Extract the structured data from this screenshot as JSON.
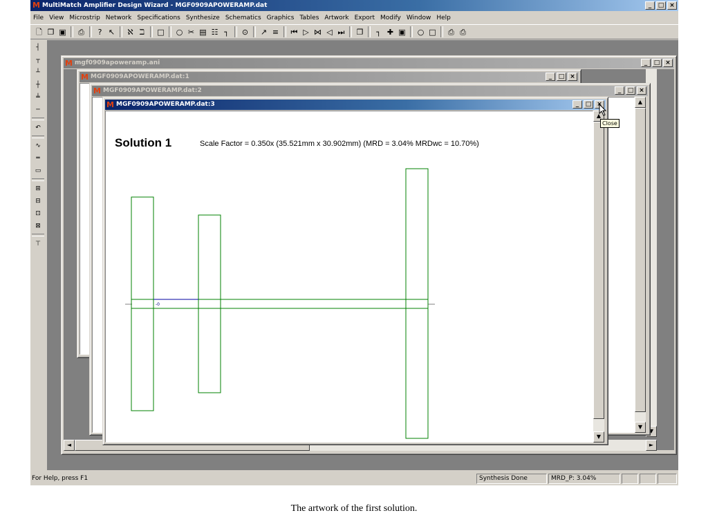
{
  "app": {
    "title": "MultiMatch Amplifier Design Wizard - MGF0909APOWERAMP.dat",
    "window_buttons": [
      "_",
      "□",
      "×"
    ]
  },
  "menu": [
    "File",
    "View",
    "Microstrip",
    "Network",
    "Specifications",
    "Synthesize",
    "Schematics",
    "Graphics",
    "Tables",
    "Artwork",
    "Export",
    "Modify",
    "Window",
    "Help"
  ],
  "toolbar_icons": [
    "new-file-icon",
    "open-folder-icon",
    "save-icon",
    "print-icon",
    "help-icon",
    "context-help-icon",
    "artwork-icon",
    "artwork-alt-icon",
    "layout-icon",
    "circle-icon",
    "scissors-icon",
    "grid-icon",
    "network-icon",
    "schematic-icon",
    "target-icon",
    "tune-icon",
    "sweep-icon",
    "first-icon",
    "play-icon",
    "next-icon",
    "prev-icon",
    "last-icon",
    "copy-icon",
    "bracket-icon",
    "plus-node-icon",
    "box-icon",
    "ring-icon",
    "square-icon",
    "print-preview-icon",
    "export-icon"
  ],
  "left_toolbar_icons": [
    "series-line-icon",
    "shunt-stub-icon",
    "open-stub-icon",
    "short-stub-icon",
    "tee-icon",
    "coupled-line-icon",
    "undo-icon",
    "resistor-icon",
    "capacitor-icon",
    "inductor-icon",
    "plus-icon",
    "minus-icon",
    "dot-icon",
    "transistor-icon",
    "antenna-icon"
  ],
  "windows": {
    "ani": {
      "title": "mgf0909apoweramp.ani"
    },
    "dat1": {
      "title": "MGF0909APOWERAMP.dat:1"
    },
    "dat2": {
      "title": "MGF0909APOWERAMP.dat:2"
    },
    "dat3": {
      "title": "MGF0909APOWERAMP.dat:3"
    }
  },
  "solution": {
    "title": "Solution 1",
    "info": "Scale Factor =  0.350x (35.521mm x 30.902mm)    (MRD = 3.04%  MRDwc = 10.70%)"
  },
  "tooltip": "Close",
  "status": {
    "help": "For Help, press F1",
    "synthesis": "Synthesis Done",
    "mrd": "MRD_P:  3.04%"
  },
  "caption": "The artwork of the first solution.",
  "colors": {
    "trace": "#008000",
    "selected_trace": "#0000a0",
    "title_active": "#0a246a"
  }
}
